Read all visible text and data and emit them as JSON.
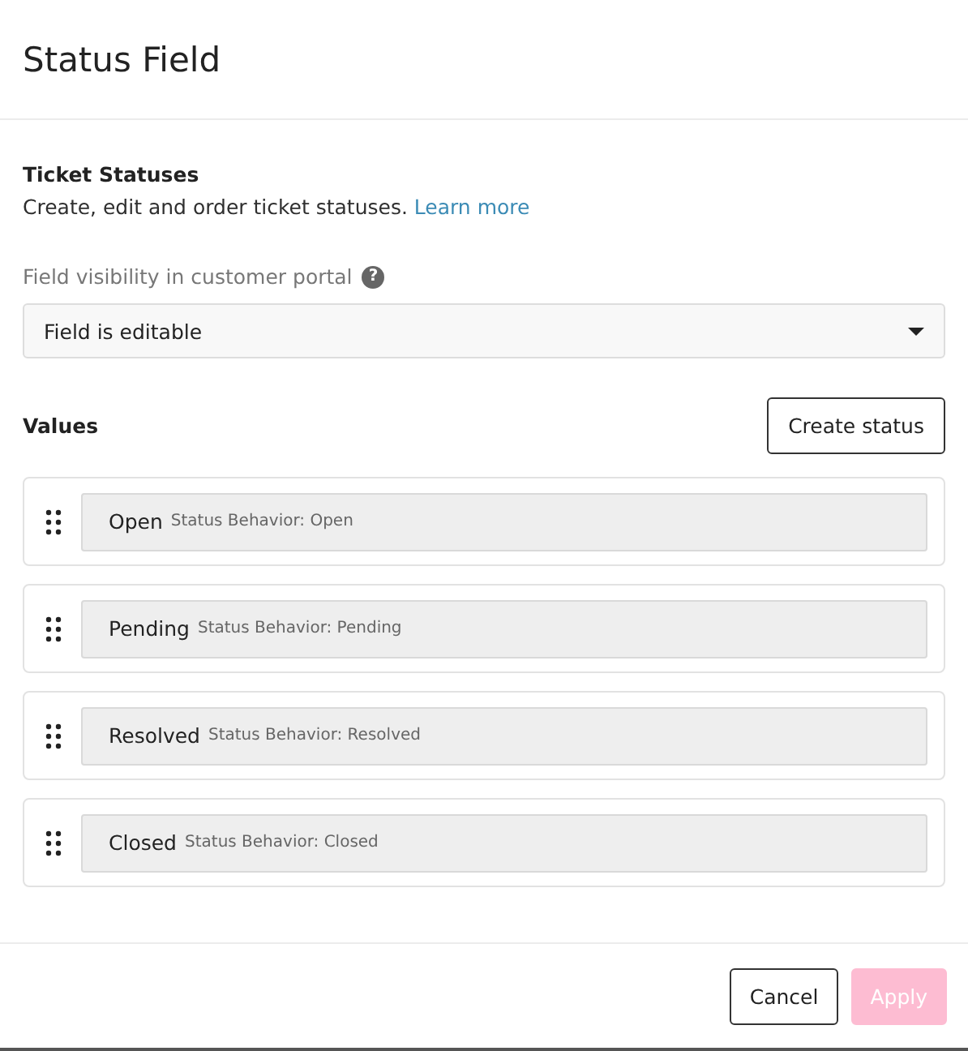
{
  "dialog": {
    "title": "Status Field"
  },
  "section": {
    "title": "Ticket Statuses",
    "description": "Create, edit and order ticket statuses.",
    "link": "Learn more"
  },
  "visibility": {
    "label": "Field visibility in customer portal",
    "help_icon": "?",
    "value": "Field is editable"
  },
  "values": {
    "title": "Values",
    "create_button": "Create status"
  },
  "statuses": [
    {
      "name": "Open",
      "behavior": "Status Behavior: Open"
    },
    {
      "name": "Pending",
      "behavior": "Status Behavior: Pending"
    },
    {
      "name": "Resolved",
      "behavior": "Status Behavior: Resolved"
    },
    {
      "name": "Closed",
      "behavior": "Status Behavior: Closed"
    }
  ],
  "footer": {
    "buttons": [
      {
        "label": "Cancel",
        "kind": "secondary",
        "disabled": false
      },
      {
        "label": "Apply",
        "kind": "primary",
        "disabled": true
      }
    ]
  }
}
